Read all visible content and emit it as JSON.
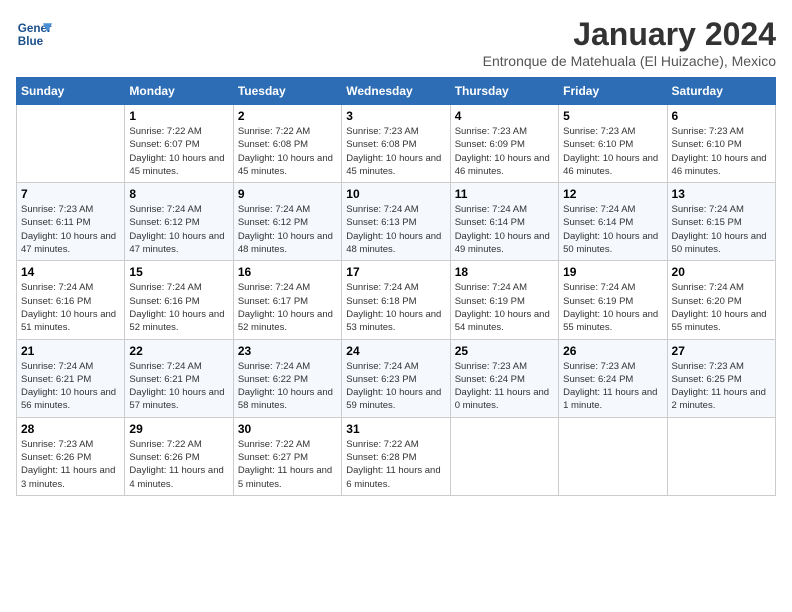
{
  "logo": {
    "line1": "General",
    "line2": "Blue"
  },
  "title": "January 2024",
  "subtitle": "Entronque de Matehuala (El Huizache), Mexico",
  "weekdays": [
    "Sunday",
    "Monday",
    "Tuesday",
    "Wednesday",
    "Thursday",
    "Friday",
    "Saturday"
  ],
  "weeks": [
    [
      {
        "day": "",
        "info": ""
      },
      {
        "day": "1",
        "info": "Sunrise: 7:22 AM\nSunset: 6:07 PM\nDaylight: 10 hours and 45 minutes."
      },
      {
        "day": "2",
        "info": "Sunrise: 7:22 AM\nSunset: 6:08 PM\nDaylight: 10 hours and 45 minutes."
      },
      {
        "day": "3",
        "info": "Sunrise: 7:23 AM\nSunset: 6:08 PM\nDaylight: 10 hours and 45 minutes."
      },
      {
        "day": "4",
        "info": "Sunrise: 7:23 AM\nSunset: 6:09 PM\nDaylight: 10 hours and 46 minutes."
      },
      {
        "day": "5",
        "info": "Sunrise: 7:23 AM\nSunset: 6:10 PM\nDaylight: 10 hours and 46 minutes."
      },
      {
        "day": "6",
        "info": "Sunrise: 7:23 AM\nSunset: 6:10 PM\nDaylight: 10 hours and 46 minutes."
      }
    ],
    [
      {
        "day": "7",
        "info": "Sunrise: 7:23 AM\nSunset: 6:11 PM\nDaylight: 10 hours and 47 minutes."
      },
      {
        "day": "8",
        "info": "Sunrise: 7:24 AM\nSunset: 6:12 PM\nDaylight: 10 hours and 47 minutes."
      },
      {
        "day": "9",
        "info": "Sunrise: 7:24 AM\nSunset: 6:12 PM\nDaylight: 10 hours and 48 minutes."
      },
      {
        "day": "10",
        "info": "Sunrise: 7:24 AM\nSunset: 6:13 PM\nDaylight: 10 hours and 48 minutes."
      },
      {
        "day": "11",
        "info": "Sunrise: 7:24 AM\nSunset: 6:14 PM\nDaylight: 10 hours and 49 minutes."
      },
      {
        "day": "12",
        "info": "Sunrise: 7:24 AM\nSunset: 6:14 PM\nDaylight: 10 hours and 50 minutes."
      },
      {
        "day": "13",
        "info": "Sunrise: 7:24 AM\nSunset: 6:15 PM\nDaylight: 10 hours and 50 minutes."
      }
    ],
    [
      {
        "day": "14",
        "info": "Sunrise: 7:24 AM\nSunset: 6:16 PM\nDaylight: 10 hours and 51 minutes."
      },
      {
        "day": "15",
        "info": "Sunrise: 7:24 AM\nSunset: 6:16 PM\nDaylight: 10 hours and 52 minutes."
      },
      {
        "day": "16",
        "info": "Sunrise: 7:24 AM\nSunset: 6:17 PM\nDaylight: 10 hours and 52 minutes."
      },
      {
        "day": "17",
        "info": "Sunrise: 7:24 AM\nSunset: 6:18 PM\nDaylight: 10 hours and 53 minutes."
      },
      {
        "day": "18",
        "info": "Sunrise: 7:24 AM\nSunset: 6:19 PM\nDaylight: 10 hours and 54 minutes."
      },
      {
        "day": "19",
        "info": "Sunrise: 7:24 AM\nSunset: 6:19 PM\nDaylight: 10 hours and 55 minutes."
      },
      {
        "day": "20",
        "info": "Sunrise: 7:24 AM\nSunset: 6:20 PM\nDaylight: 10 hours and 55 minutes."
      }
    ],
    [
      {
        "day": "21",
        "info": "Sunrise: 7:24 AM\nSunset: 6:21 PM\nDaylight: 10 hours and 56 minutes."
      },
      {
        "day": "22",
        "info": "Sunrise: 7:24 AM\nSunset: 6:21 PM\nDaylight: 10 hours and 57 minutes."
      },
      {
        "day": "23",
        "info": "Sunrise: 7:24 AM\nSunset: 6:22 PM\nDaylight: 10 hours and 58 minutes."
      },
      {
        "day": "24",
        "info": "Sunrise: 7:24 AM\nSunset: 6:23 PM\nDaylight: 10 hours and 59 minutes."
      },
      {
        "day": "25",
        "info": "Sunrise: 7:23 AM\nSunset: 6:24 PM\nDaylight: 11 hours and 0 minutes."
      },
      {
        "day": "26",
        "info": "Sunrise: 7:23 AM\nSunset: 6:24 PM\nDaylight: 11 hours and 1 minute."
      },
      {
        "day": "27",
        "info": "Sunrise: 7:23 AM\nSunset: 6:25 PM\nDaylight: 11 hours and 2 minutes."
      }
    ],
    [
      {
        "day": "28",
        "info": "Sunrise: 7:23 AM\nSunset: 6:26 PM\nDaylight: 11 hours and 3 minutes."
      },
      {
        "day": "29",
        "info": "Sunrise: 7:22 AM\nSunset: 6:26 PM\nDaylight: 11 hours and 4 minutes."
      },
      {
        "day": "30",
        "info": "Sunrise: 7:22 AM\nSunset: 6:27 PM\nDaylight: 11 hours and 5 minutes."
      },
      {
        "day": "31",
        "info": "Sunrise: 7:22 AM\nSunset: 6:28 PM\nDaylight: 11 hours and 6 minutes."
      },
      {
        "day": "",
        "info": ""
      },
      {
        "day": "",
        "info": ""
      },
      {
        "day": "",
        "info": ""
      }
    ]
  ]
}
